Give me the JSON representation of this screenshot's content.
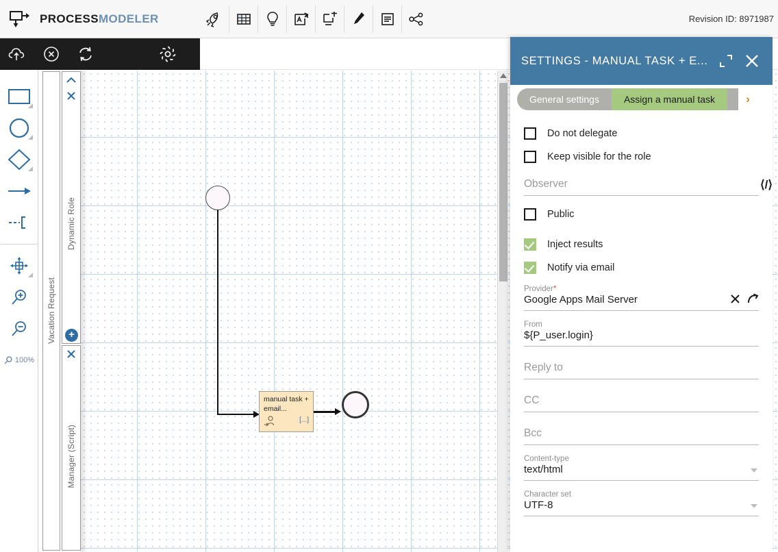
{
  "app": {
    "brand_primary": "PROCESS",
    "brand_secondary": "MODELER",
    "revision": "Revision ID: 8971987"
  },
  "toolbar": {
    "icons": [
      {
        "name": "rocket-icon",
        "title": "Deploy"
      },
      {
        "name": "grid-icon",
        "title": "Grid"
      },
      {
        "name": "lightbulb-icon",
        "title": "Ideas"
      },
      {
        "name": "pdf-export-icon",
        "title": "Export PDF"
      },
      {
        "name": "add-panel-icon",
        "title": "Add element"
      },
      {
        "name": "marker-icon",
        "title": "Highlight"
      },
      {
        "name": "document-icon",
        "title": "Documentation"
      },
      {
        "name": "share-graph-icon",
        "title": "Share"
      }
    ]
  },
  "subtoolbar": {
    "icons": [
      {
        "name": "cloud-upload-icon",
        "title": "Publish"
      },
      {
        "name": "close-circle-icon",
        "title": "Discard"
      },
      {
        "name": "sync-icon",
        "title": "Refresh"
      },
      {
        "name": "gear-icon",
        "title": "Settings"
      }
    ]
  },
  "palette": {
    "tools": [
      {
        "name": "rectangle-tool",
        "expandable": true
      },
      {
        "name": "circle-tool",
        "expandable": true
      },
      {
        "name": "diamond-tool",
        "expandable": true
      },
      {
        "name": "arrow-tool",
        "expandable": false
      },
      {
        "name": "dashed-connector-tool",
        "expandable": false
      },
      {
        "name": "move-tool",
        "expandable": true
      },
      {
        "name": "zoom-in-tool",
        "expandable": false
      },
      {
        "name": "zoom-out-tool",
        "expandable": false
      }
    ],
    "zoom_level": "100%"
  },
  "diagram": {
    "pool_label": "Vacation Request",
    "lanes": [
      {
        "label": "Dynamic Role"
      },
      {
        "label": "Manager (Script)"
      }
    ],
    "add_lane_label": "+",
    "nodes": [
      {
        "name": "start-event",
        "label": ""
      },
      {
        "name": "manual-task",
        "label": "manual task + email...",
        "marker": "[...]"
      },
      {
        "name": "end-event",
        "label": ""
      }
    ]
  },
  "panel": {
    "title": "SETTINGS  -  MANUAL TASK + E...",
    "expand_label": "Expand",
    "close_label": "Close",
    "tabs": [
      {
        "label": "General settings",
        "active": false
      },
      {
        "label": "Assign a manual task",
        "active": true
      }
    ],
    "tab_next": "›",
    "checkboxes": [
      {
        "label": "Do not delegate",
        "checked": false
      },
      {
        "label": "Keep visible for the role",
        "checked": false
      },
      {
        "label": "Public",
        "checked": false
      },
      {
        "label": "Inject results",
        "checked": true
      },
      {
        "label": "Notify via email",
        "checked": true
      }
    ],
    "fields": {
      "observer": {
        "label": "",
        "placeholder": "Observer",
        "value": ""
      },
      "provider": {
        "label": "Provider",
        "required": "*",
        "value": "Google Apps Mail Server"
      },
      "from": {
        "label": "From",
        "value": "${P_user.login}"
      },
      "reply_to": {
        "label": "",
        "placeholder": "Reply to",
        "value": ""
      },
      "cc": {
        "label": "",
        "placeholder": "CC",
        "value": ""
      },
      "bcc": {
        "label": "",
        "placeholder": "Bcc",
        "value": ""
      },
      "content_type": {
        "label": "Content-type",
        "value": "text/html"
      },
      "character_set": {
        "label": "Character set",
        "value": "UTF-8"
      }
    },
    "colors": {
      "header": "#437aa3",
      "tab_active": "#a5c97e",
      "tab_inactive": "#b0b0ab",
      "required": "#e04b4b"
    }
  }
}
